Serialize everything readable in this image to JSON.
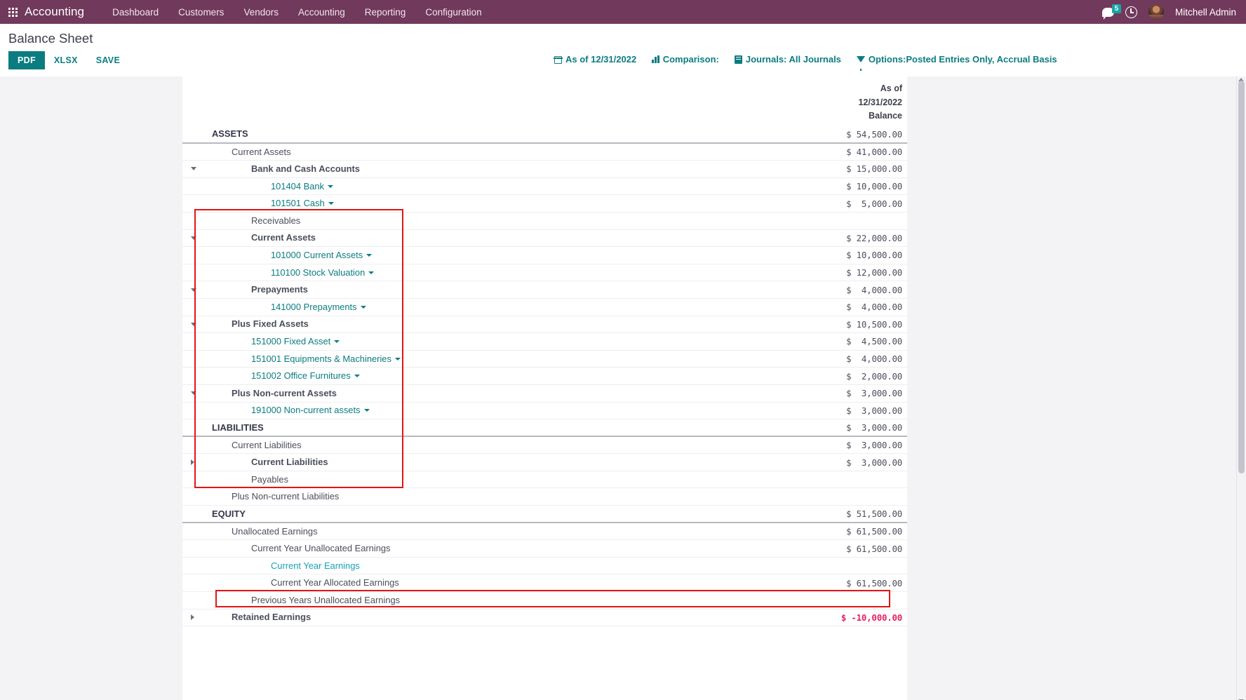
{
  "navbar": {
    "apps_icon": "apps-grid-icon",
    "brand": "Accounting",
    "menu": [
      "Dashboard",
      "Customers",
      "Vendors",
      "Accounting",
      "Reporting",
      "Configuration"
    ],
    "messages_icon": "chat-bubble-icon",
    "messages_count": "5",
    "activities_icon": "clock-icon",
    "avatar_icon": "user-avatar",
    "user_name": "Mitchell Admin",
    "bg_color": "#71395b"
  },
  "control_panel": {
    "page_title": "Balance Sheet",
    "buttons": [
      {
        "label": "PDF",
        "style": "primary",
        "name": "pdf-button"
      },
      {
        "label": "XLSX",
        "style": "link",
        "name": "xlsx-button"
      },
      {
        "label": "SAVE",
        "style": "link",
        "name": "save-button"
      }
    ],
    "filters": [
      {
        "icon": "calendar-icon",
        "label": "As of 12/31/2022",
        "name": "date-filter"
      },
      {
        "icon": "bar-chart-icon",
        "label": "Comparison:",
        "name": "comparison-filter"
      },
      {
        "icon": "book-icon",
        "label": "Journals: All Journals",
        "name": "journals-filter"
      },
      {
        "icon": "funnel-icon",
        "label": "Options:Posted Entries Only, Accrual Basis",
        "name": "options-filter"
      }
    ],
    "accent_color": "#0b7c81"
  },
  "report": {
    "column_header": {
      "line1": "As of",
      "line2": "12/31/2022",
      "line3": "Balance"
    },
    "rows": [
      {
        "name": "ASSETS",
        "value": "$ 54,500.00",
        "indent": 0,
        "style": "section",
        "caret": "none",
        "rule": "below-strong"
      },
      {
        "name": "Current Assets",
        "value": "$ 41,000.00",
        "indent": 1,
        "style": "plain",
        "caret": "none"
      },
      {
        "name": "Bank and Cash Accounts",
        "value": "$ 15,000.00",
        "indent": 2,
        "style": "bold",
        "caret": "down"
      },
      {
        "name": "101404 Bank",
        "value": "$ 10,000.00",
        "indent": 3,
        "style": "account",
        "caret": "none"
      },
      {
        "name": "101501 Cash",
        "value": "$  5,000.00",
        "indent": 3,
        "style": "account",
        "caret": "none"
      },
      {
        "name": "Receivables",
        "value": "",
        "indent": 2,
        "style": "plain",
        "caret": "none"
      },
      {
        "name": "Current Assets",
        "value": "$ 22,000.00",
        "indent": 2,
        "style": "bold",
        "caret": "down"
      },
      {
        "name": "101000 Current Assets",
        "value": "$ 10,000.00",
        "indent": 3,
        "style": "account",
        "caret": "none"
      },
      {
        "name": "110100 Stock Valuation",
        "value": "$ 12,000.00",
        "indent": 3,
        "style": "account",
        "caret": "none"
      },
      {
        "name": "Prepayments",
        "value": "$  4,000.00",
        "indent": 2,
        "style": "bold",
        "caret": "down"
      },
      {
        "name": "141000 Prepayments",
        "value": "$  4,000.00",
        "indent": 3,
        "style": "account",
        "caret": "none"
      },
      {
        "name": "Plus Fixed Assets",
        "value": "$ 10,500.00",
        "indent": 1,
        "style": "bold",
        "caret": "down"
      },
      {
        "name": "151000 Fixed Asset",
        "value": "$  4,500.00",
        "indent": 2,
        "style": "account",
        "caret": "none"
      },
      {
        "name": "151001 Equipments & Machineries",
        "value": "$  4,000.00",
        "indent": 2,
        "style": "account",
        "caret": "none"
      },
      {
        "name": "151002 Office Furnitures",
        "value": "$  2,000.00",
        "indent": 2,
        "style": "account",
        "caret": "none"
      },
      {
        "name": "Plus Non-current Assets",
        "value": "$  3,000.00",
        "indent": 1,
        "style": "bold",
        "caret": "down"
      },
      {
        "name": "191000 Non-current assets",
        "value": "$  3,000.00",
        "indent": 2,
        "style": "account",
        "caret": "none"
      },
      {
        "name": "LIABILITIES",
        "value": "$  3,000.00",
        "indent": 0,
        "style": "section",
        "caret": "none",
        "rule": "below-strong"
      },
      {
        "name": "Current Liabilities",
        "value": "$  3,000.00",
        "indent": 1,
        "style": "plain",
        "caret": "none"
      },
      {
        "name": "Current Liabilities",
        "value": "$  3,000.00",
        "indent": 2,
        "style": "bold",
        "caret": "right"
      },
      {
        "name": "Payables",
        "value": "",
        "indent": 2,
        "style": "plain",
        "caret": "none"
      },
      {
        "name": "Plus Non-current Liabilities",
        "value": "",
        "indent": 1,
        "style": "plain",
        "caret": "none"
      },
      {
        "name": "EQUITY",
        "value": "$ 51,500.00",
        "indent": 0,
        "style": "section",
        "caret": "none",
        "rule": "below-strong"
      },
      {
        "name": "Unallocated Earnings",
        "value": "$ 61,500.00",
        "indent": 1,
        "style": "plain",
        "caret": "none"
      },
      {
        "name": "Current Year Unallocated Earnings",
        "value": "$ 61,500.00",
        "indent": 2,
        "style": "plain",
        "caret": "none"
      },
      {
        "name": "Current Year Earnings",
        "value": "",
        "indent": 3,
        "style": "link",
        "caret": "none"
      },
      {
        "name": "Current Year Allocated Earnings",
        "value": "$ 61,500.00",
        "indent": 3,
        "style": "plain",
        "caret": "none"
      },
      {
        "name": "Previous Years Unallocated Earnings",
        "value": "",
        "indent": 2,
        "style": "plain",
        "caret": "none"
      },
      {
        "name": "Retained Earnings",
        "value": "$ -10,000.00",
        "indent": 1,
        "style": "bold",
        "caret": "right",
        "value_style": "negative"
      }
    ],
    "negative_color": "#e6215e"
  },
  "annotations": [
    {
      "name": "assets-highlight-box",
      "color": "#e51414"
    },
    {
      "name": "unallocated-earnings-highlight-box",
      "color": "#e51414"
    }
  ]
}
